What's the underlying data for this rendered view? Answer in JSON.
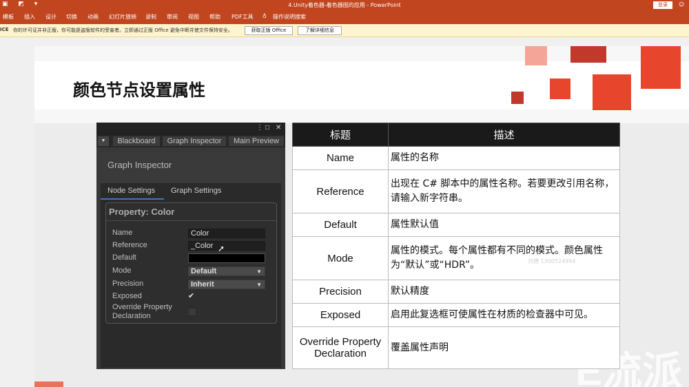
{
  "window": {
    "quick_access": "▣ ◩ ▾",
    "title": "4.Unity着色器-着色器图的应用 - PowerPoint",
    "login_button": "登录",
    "account_icon": "user-icon"
  },
  "ribbon": {
    "tabs": [
      "模板",
      "插入",
      "设计",
      "切换",
      "动画",
      "幻灯片放映",
      "录制",
      "审阅",
      "视图",
      "帮助",
      "PDF工具",
      "操作说明搜索"
    ],
    "search_icon": "lightbulb-icon"
  },
  "license_bar": {
    "label": "ICE",
    "message": "你的许可证并非正版，你可能是盗版软件的受害者。立即通过正版 Office 避免中断并使文件保持安全。",
    "get_office_button": "获取正版 Office",
    "learn_more_button": "了解详细信息"
  },
  "slide": {
    "title": "颜色节点设置属性",
    "watermark": "E流派",
    "overlay_id": "刘德 1300524994",
    "accent_colors": [
      "#f5a597",
      "#c0392b",
      "#e8462c"
    ]
  },
  "unity": {
    "window_icons": [
      "⋮",
      "□",
      "✕"
    ],
    "tabs": [
      "Blackboard",
      "Graph Inspector",
      "Main Preview"
    ],
    "panel_title": "Graph Inspector",
    "subtabs": [
      "Node Settings",
      "Graph Settings"
    ],
    "property_header": "Property: Color",
    "rows": {
      "name": {
        "label": "Name",
        "value": "Color"
      },
      "reference": {
        "label": "Reference",
        "value": "_Color"
      },
      "default": {
        "label": "Default",
        "value_color": "#000000"
      },
      "mode": {
        "label": "Mode",
        "value": "Default"
      },
      "precision": {
        "label": "Precision",
        "value": "Inherit"
      },
      "exposed": {
        "label": "Exposed",
        "checked": "✔"
      },
      "override": {
        "label_line1": "Override Property",
        "label_line2": "Declaration"
      }
    }
  },
  "table": {
    "headers": [
      "标题",
      "描述"
    ],
    "rows": [
      {
        "name": "Name",
        "desc": "属性的名称"
      },
      {
        "name": "Reference",
        "desc": "出现在 C# 脚本中的属性名称。若要更改引用名称，请输入新字符串。"
      },
      {
        "name": "Default",
        "desc": "属性默认值"
      },
      {
        "name": "Mode",
        "desc": "属性的模式。每个属性都有不同的模式。颜色属性为“默认”或“HDR”。"
      },
      {
        "name": "Precision",
        "desc": "默认精度"
      },
      {
        "name": "Exposed",
        "desc": "启用此复选框可使属性在材质的检查器中可见。"
      },
      {
        "name_line1": "Override Property",
        "name_line2": "Declaration",
        "desc": "覆盖属性声明"
      }
    ]
  }
}
